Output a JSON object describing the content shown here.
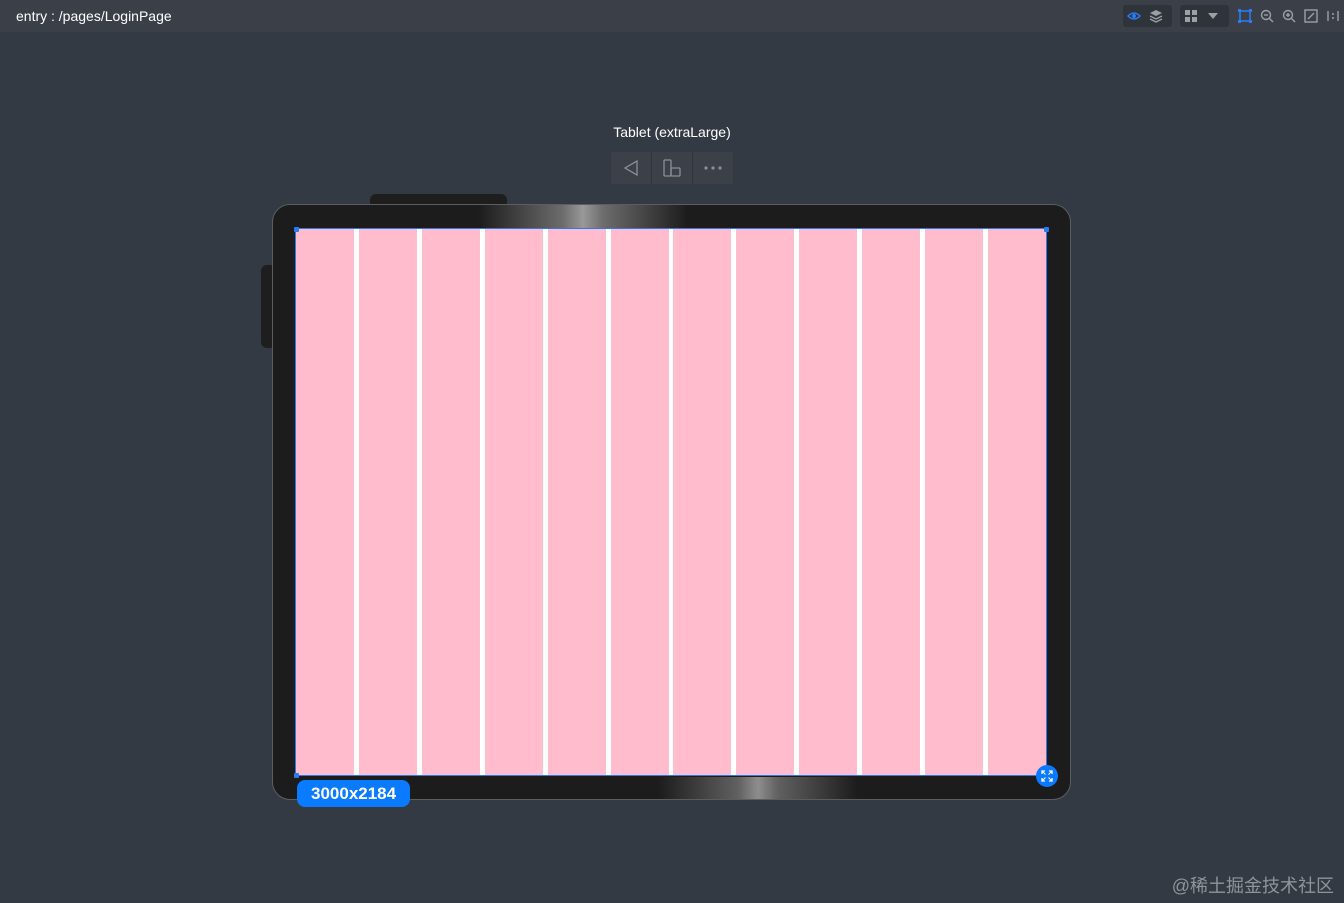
{
  "header": {
    "page_path": "entry : /pages/LoginPage"
  },
  "toolbar": {
    "icons": [
      "eye-icon",
      "layers-icon",
      "components-icon",
      "dropdown-arrow-icon",
      "select-frame-icon",
      "zoom-out-icon",
      "zoom-in-icon",
      "fit-screen-icon",
      "actual-size-icon"
    ]
  },
  "device": {
    "title": "Tablet (extraLarge)",
    "controls": [
      "back-triangle-icon",
      "rotate-device-icon",
      "more-icon"
    ],
    "resolution": "3000x2184",
    "grid_columns": 12
  },
  "colors": {
    "background": "#343a43",
    "accent": "#0a7aff",
    "grid_column": "#ffbccd",
    "tablet_frame": "#1c1c1c"
  },
  "watermark": "@稀土掘金技术社区"
}
